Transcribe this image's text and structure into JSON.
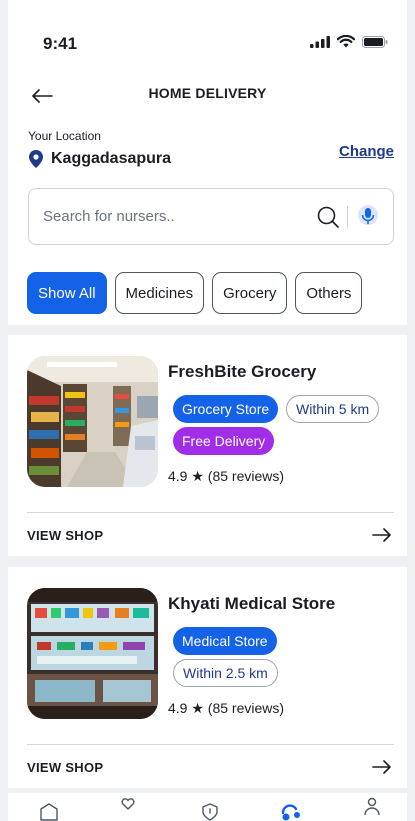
{
  "status_bar": {
    "time": "9:41"
  },
  "header": {
    "title": "HOME DELIVERY"
  },
  "location": {
    "label": "Your Location",
    "name": "Kaggadasapura",
    "change_label": "Change"
  },
  "search": {
    "placeholder": "Search for nursers.."
  },
  "filters": [
    {
      "label": "Show All",
      "active": true
    },
    {
      "label": "Medicines",
      "active": false
    },
    {
      "label": "Grocery",
      "active": false
    },
    {
      "label": "Others",
      "active": false
    }
  ],
  "shops": [
    {
      "name": "FreshBite Grocery",
      "type_tag": "Grocery Store",
      "distance_tag": "Within 5 km",
      "delivery_tag": "Free Delivery",
      "rating": "4.9 ★ (85 reviews)",
      "view_label": "VIEW SHOP"
    },
    {
      "name": "Khyati Medical Store",
      "type_tag": "Medical Store",
      "distance_tag": "Within 2.5 km",
      "rating": "4.9 ★ (85 reviews)",
      "view_label": "VIEW SHOP"
    }
  ],
  "bottom_nav": [
    {
      "icon": "home-icon"
    },
    {
      "icon": "heart-icon"
    },
    {
      "icon": "shield-icon"
    },
    {
      "icon": "delivery-icon",
      "active": true
    },
    {
      "icon": "profile-icon"
    }
  ],
  "colors": {
    "primary": "#1362e8",
    "link": "#1e3a8a",
    "free_delivery": "#a12ee6",
    "background": "#eef0f3"
  }
}
